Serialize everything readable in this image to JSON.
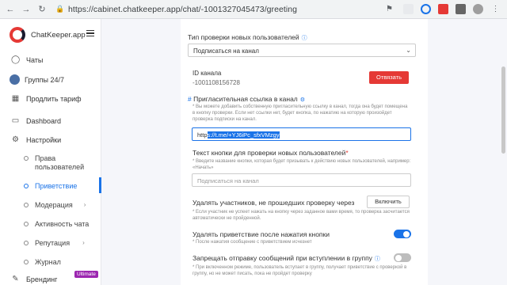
{
  "browser": {
    "url": "https://cabinet.chatkeeper.app/chat/-1001327045473/greeting"
  },
  "sidebar": {
    "brand": "ChatKeeper.app",
    "items": [
      {
        "label": "Чаты",
        "icon": "chat-icon"
      },
      {
        "label": "Группы 24/7",
        "icon": "group-avatar"
      },
      {
        "label": "Продлить тариф",
        "icon": "calendar-icon"
      },
      {
        "label": "Dashboard",
        "icon": "monitor-icon"
      },
      {
        "label": "Настройки",
        "icon": "gear-icon"
      }
    ],
    "sub_items": [
      {
        "label": "Права\nпользователей"
      },
      {
        "label": "Приветствие",
        "active": true
      },
      {
        "label": "Модерация"
      },
      {
        "label": "Активность чата"
      },
      {
        "label": "Репутация"
      },
      {
        "label": "Журнал"
      }
    ],
    "branding_label": "Брендинг",
    "ultimate_badge": "Ultimate"
  },
  "form": {
    "check_type_label": "Тип проверки новых пользователей",
    "check_type_value": "Подписаться на канал",
    "channel_id_label": "ID канала",
    "channel_id_value": "-1001108156728",
    "unbind_button": "Отвязать",
    "invite_link_label": "Пригласительная ссылка в канал",
    "invite_link_hint": "* Вы можете добавить собственную пригласительную ссылку в канал, тогда она будет помещена в кнопку проверки. Если нет ссылки нет, будет кнопка, по нажатию на которую произойдет проверка подписки на канал.",
    "invite_link_prefix": "http",
    "invite_link_selected": "s://t.me/+YJ6iPc_sfxVMzgy",
    "button_text_label": "Текст кнопки для проверки новых пользователей",
    "button_text_hint": "* Введите название кнопки, которая будет призывать к действию новых пользователей, например: «Начать»",
    "button_text_placeholder": "Подписаться на канал",
    "remove_failed_label": "Удалять участников, не прошедших проверку через",
    "enable_button": "Включить",
    "remove_failed_hint": "* Если участник не успеет нажать на кнопку через заданное вами время, то проверка засчитается автоматически не пройденной.",
    "delete_greeting_label": "Удалять приветствие после нажатия кнопки",
    "delete_greeting_hint": "* После нажатия сообщение с приветствием исчезнет",
    "delete_greeting_on": true,
    "forbid_messages_label": "Запрещать отправку сообщений при вступлении в группу",
    "forbid_messages_hint": "* При включенном режиме, пользователь вступает в группу, получает приветствие с проверкой в группу, но не может писать, пока не пройдет проверку",
    "forbid_messages_on": false
  },
  "colors": {
    "accent": "#1a73e8",
    "danger": "#e53935",
    "ultimate": "#9c27b0"
  }
}
